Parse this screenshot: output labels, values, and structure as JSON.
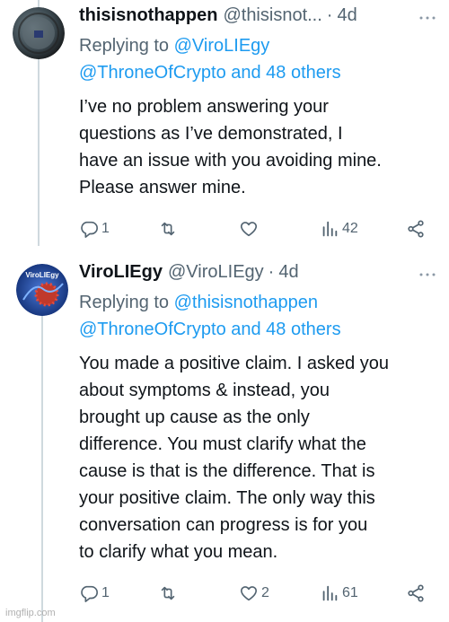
{
  "tweets": [
    {
      "name": "thisisnothappen",
      "handle": "@thisisnot...",
      "time": "4d",
      "replying_prefix": "Replying to ",
      "replying_mention_1": "@ViroLIEgy",
      "replying_mention_2": "@ThroneOfCrypto and 48 others",
      "text_lines": [
        "I’ve no problem answering your",
        "questions as I’ve demonstrated, I",
        "have an issue with you avoiding mine.",
        "Please answer mine."
      ],
      "replies": "1",
      "likes": "",
      "views": "42"
    },
    {
      "name": "ViroLIEgy",
      "handle": "@ViroLIEgy",
      "time": "4d",
      "replying_prefix": "Replying to ",
      "replying_mention_1": "@thisisnothappen",
      "replying_mention_2": "@ThroneOfCrypto and 48 others",
      "text_lines": [
        "You made a positive claim. I asked you",
        "about symptoms & instead, you",
        "brought up cause as the only",
        "difference. You must clarify what the",
        "cause is that is the difference. That is",
        "your positive claim. The only way this",
        "conversation can progress is for you",
        "to clarify what you mean."
      ],
      "replies": "1",
      "likes": "2",
      "views": "61",
      "avatar_text": "ViroLIEgy"
    }
  ],
  "separator": "·",
  "more_icon": "more-dots-icon",
  "watermark": "imgflip.com",
  "colors": {
    "link": "#1d9bf0",
    "muted": "#536471",
    "text": "#0f1419"
  }
}
